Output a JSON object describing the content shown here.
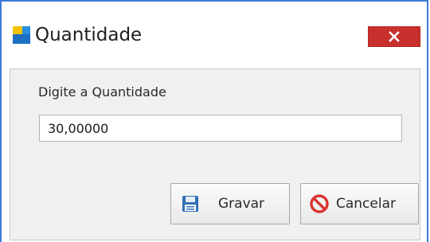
{
  "window": {
    "title": "Quantidade",
    "app_icon": "app-logo-icon",
    "close_icon": "close-icon",
    "close_color": "#c7302c"
  },
  "form": {
    "label": "Digite a Quantidade",
    "quantity_value": "30,00000"
  },
  "buttons": {
    "save_label": "Gravar",
    "save_icon": "floppy-disk-icon",
    "cancel_label": "Cancelar",
    "cancel_icon": "prohibited-icon"
  },
  "colors": {
    "window_border": "#3a7bd5",
    "content_background": "#f0f0f0"
  }
}
